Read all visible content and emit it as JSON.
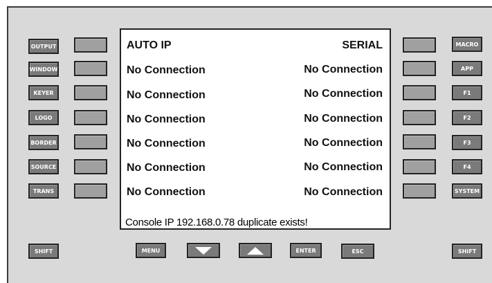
{
  "left_buttons": [
    "OUTPUT",
    "WINDOW",
    "KEYER",
    "LOGO",
    "BORDER",
    "SOURCE",
    "TRANS"
  ],
  "right_buttons": [
    "MACRO",
    "APP",
    "F1",
    "F2",
    "F3",
    "F4",
    "SYSTEM"
  ],
  "screen": {
    "header_left": "AUTO IP",
    "header_right": "SERIAL",
    "rows": [
      {
        "left": "No Connection",
        "right": "No Connection"
      },
      {
        "left": "No Connection",
        "right": "No Connection"
      },
      {
        "left": "No Connection",
        "right": "No Connection"
      },
      {
        "left": "No Connection",
        "right": "No Connection"
      },
      {
        "left": "No Connection",
        "right": "No Connection"
      },
      {
        "left": "No Connection",
        "right": "No Connection"
      }
    ],
    "message": "Console IP 192.168.0.78 duplicate exists!"
  },
  "bottom": {
    "shift_left": "SHIFT",
    "menu": "MENU",
    "down_icon": "down-arrow-icon",
    "up_icon": "up-arrow-icon",
    "enter": "ENTER",
    "esc": "ESC",
    "shift_right": "SHIFT"
  },
  "colors": {
    "panel": "#d9d9d9",
    "button": "#7a7a7a",
    "soft_key": "#a0a0a0",
    "screen": "#ffffff"
  }
}
